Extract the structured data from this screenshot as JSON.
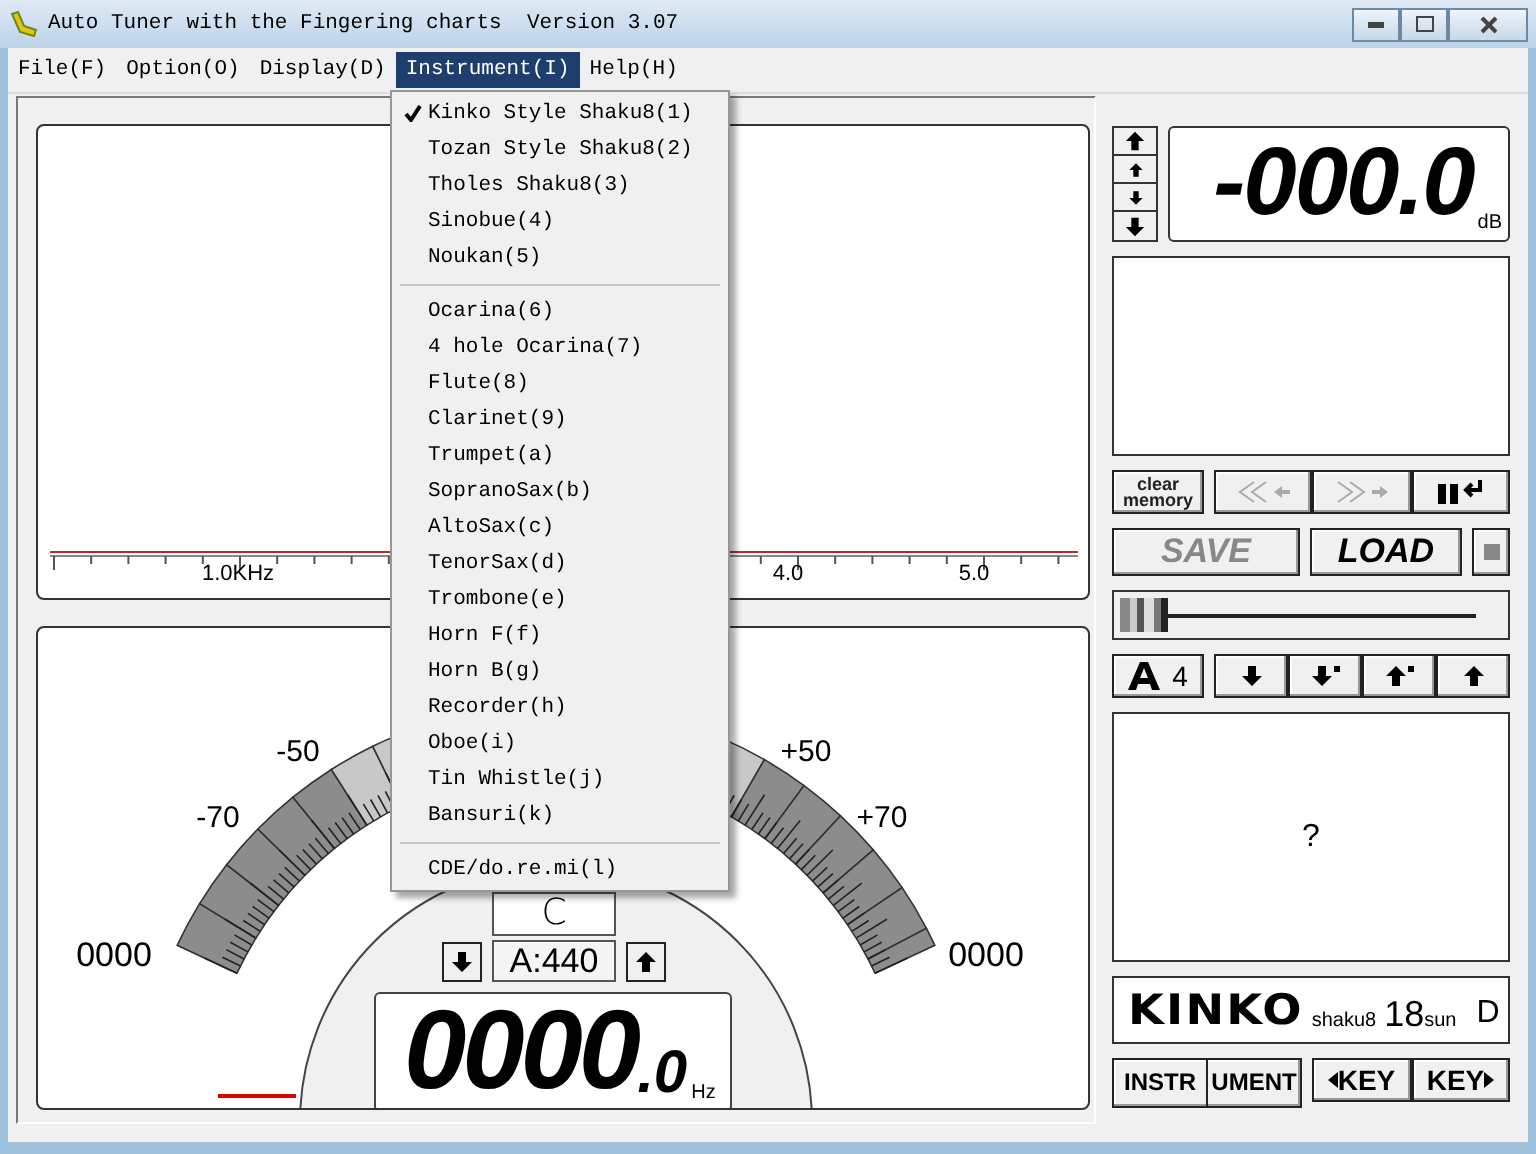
{
  "window": {
    "title": "Auto Tuner with the Fingering charts  Version 3.07"
  },
  "menu_bar": [
    {
      "label": "File(F)",
      "selected": false
    },
    {
      "label": "Option(O)",
      "selected": false
    },
    {
      "label": "Display(D)",
      "selected": false
    },
    {
      "label": "Instrument(I)",
      "selected": true
    },
    {
      "label": "Help(H)",
      "selected": false
    }
  ],
  "instrument_menu": {
    "groups": [
      [
        {
          "label": "Kinko Style Shaku8(1)",
          "checked": true
        },
        {
          "label": "Tozan Style Shaku8(2)",
          "checked": false
        },
        {
          "label": "Tholes Shaku8(3)",
          "checked": false
        },
        {
          "label": "Sinobue(4)",
          "checked": false
        },
        {
          "label": "Noukan(5)",
          "checked": false
        }
      ],
      [
        {
          "label": "Ocarina(6)",
          "checked": false
        },
        {
          "label": "4 hole Ocarina(7)",
          "checked": false
        },
        {
          "label": "Flute(8)",
          "checked": false
        },
        {
          "label": "Clarinet(9)",
          "checked": false
        },
        {
          "label": "Trumpet(a)",
          "checked": false
        },
        {
          "label": "SopranoSax(b)",
          "checked": false
        },
        {
          "label": "AltoSax(c)",
          "checked": false
        },
        {
          "label": "TenorSax(d)",
          "checked": false
        },
        {
          "label": "Trombone(e)",
          "checked": false
        },
        {
          "label": "Horn F(f)",
          "checked": false
        },
        {
          "label": "Horn B(g)",
          "checked": false
        },
        {
          "label": "Recorder(h)",
          "checked": false
        },
        {
          "label": "Oboe(i)",
          "checked": false
        },
        {
          "label": "Tin Whistle(j)",
          "checked": false
        },
        {
          "label": "Bansuri(k)",
          "checked": false
        }
      ],
      [
        {
          "label": "CDE/do.re.mi(l)",
          "checked": false
        }
      ]
    ]
  },
  "spectrum": {
    "axis_labels": [
      "1.0KHz",
      "4.0",
      "5.0"
    ]
  },
  "tuning_meter": {
    "scale_labels": [
      "-70",
      "-50",
      "+50",
      "+70"
    ],
    "left_reading": "0000",
    "right_reading": "0000",
    "note": "C",
    "reference": "A:440",
    "frequency": "0000",
    "frequency_decimal": ".0",
    "frequency_unit": "Hz"
  },
  "level_display": {
    "value": "-000.0",
    "unit": "dB"
  },
  "memory": {
    "clear_label": "clear memory"
  },
  "playback": [
    {
      "disabled": true
    },
    {
      "disabled": true
    },
    {
      "disabled": false
    }
  ],
  "save": {
    "label": "SAVE",
    "disabled": true
  },
  "load": {
    "label": "LOAD",
    "disabled": false
  },
  "slider": {
    "level": 0
  },
  "transpose": {
    "value": "4"
  },
  "fingering": {
    "text": "?"
  },
  "instrument_name": {
    "style": "KINKO",
    "type": "shaku8",
    "length": "18",
    "length_unit": "sun",
    "key": "D"
  },
  "bottom_buttons": {
    "instrument_parts": [
      "INSTR",
      "UMENT"
    ],
    "prev_key": "KEY",
    "next_key": "KEY"
  }
}
